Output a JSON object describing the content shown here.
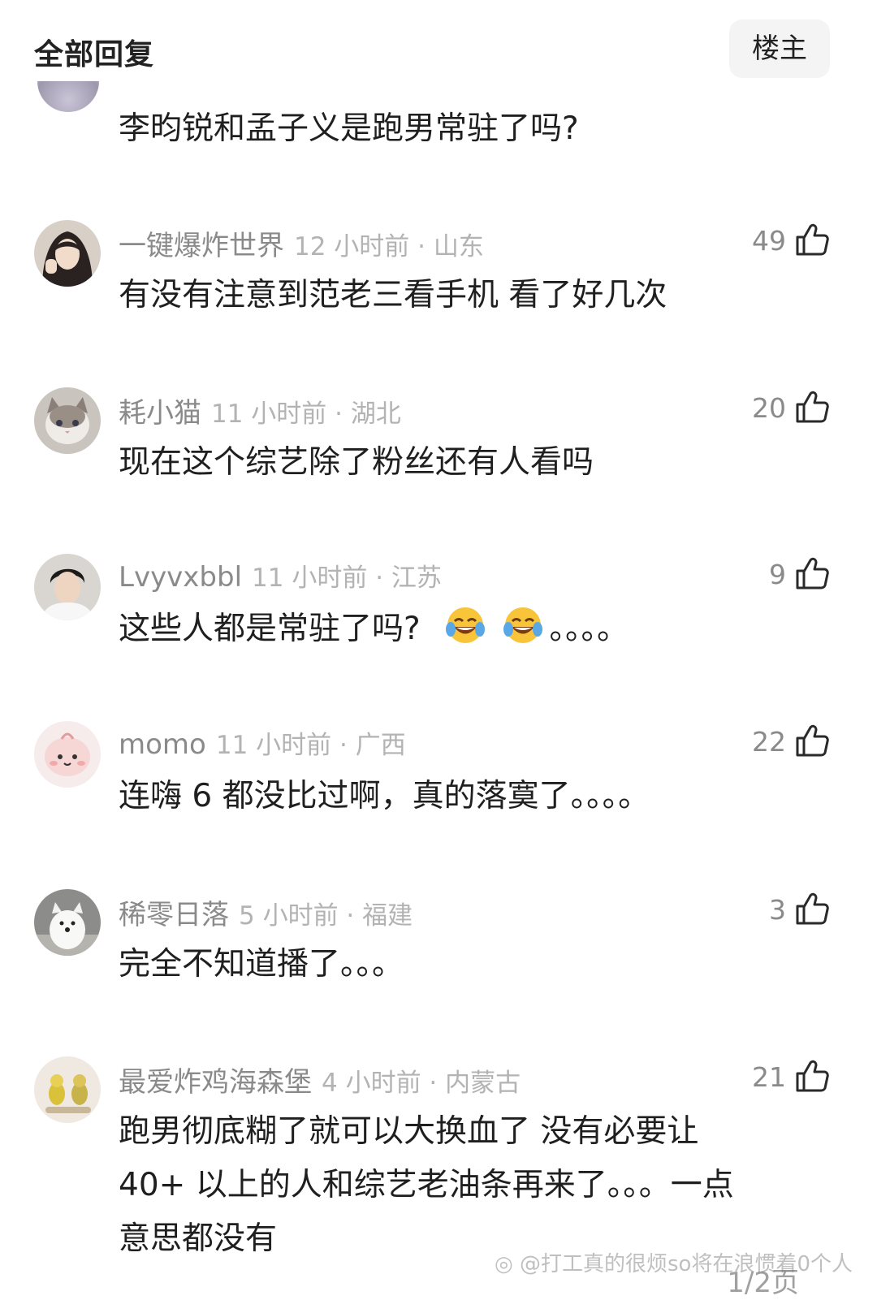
{
  "header": {
    "title": "全部回复",
    "op_button": "楼主"
  },
  "top_comment": {
    "content": "李昀锐和孟子义是跑男常驻了吗?"
  },
  "comments": [
    {
      "username": "一键爆炸世界",
      "meta": "12 小时前 · 山东",
      "likes": "49",
      "content": "有没有注意到范老三看手机 看了好几次",
      "avatar_icon": "portrait-woman-avatar"
    },
    {
      "username": "耗小猫",
      "meta": "11 小时前 · 湖北",
      "likes": "20",
      "content": "现在这个综艺除了粉丝还有人看吗",
      "avatar_icon": "cat-avatar"
    },
    {
      "username": "Lvyvxbbl",
      "meta": "11 小时前 · 江苏",
      "likes": "9",
      "content": "这些人都是常驻了吗?",
      "content_suffix": "。。。。",
      "emojis": [
        "laughing-crying-emoji",
        "laughing-crying-emoji"
      ],
      "avatar_icon": "portrait-woman-avatar"
    },
    {
      "username": "momo",
      "meta": "11 小时前 · 广西",
      "likes": "22",
      "content": "连嗨 6 都没比过啊，真的落寞了。。。。",
      "avatar_icon": "cartoon-avatar"
    },
    {
      "username": "稀零日落",
      "meta": "5 小时前 · 福建",
      "likes": "3",
      "content": "完全不知道播了。。。",
      "avatar_icon": "white-dog-avatar"
    },
    {
      "username": "最爱炸鸡海森堡",
      "meta": "4 小时前 · 内蒙古",
      "likes": "21",
      "content_lines": [
        "跑男彻底糊了就可以大换血了 没有必要让",
        "40+ 以上的人和综艺老油条再来了。。。一点",
        "意思都没有"
      ],
      "avatar_icon": "toy-figures-avatar"
    }
  ],
  "watermark": {
    "text": "@打工真的很烦so将在浪惯着0个人",
    "page": "1/2页"
  },
  "colors": {
    "text_primary": "#1f1f1f",
    "text_secondary": "#8a8a8a",
    "text_meta": "#b3b3b3",
    "button_bg": "#f4f4f4"
  }
}
